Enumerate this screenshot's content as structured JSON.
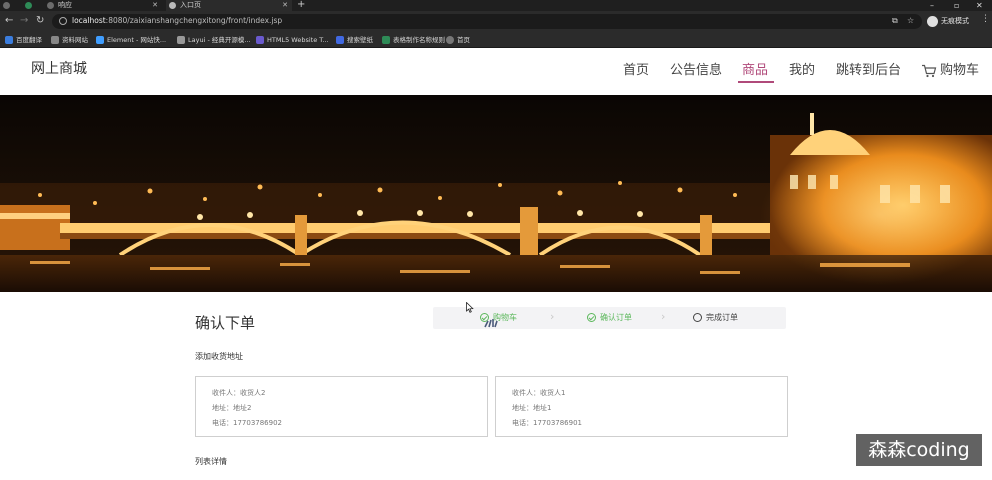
{
  "browser": {
    "tabs": [
      {
        "label": "",
        "active": false
      },
      {
        "label": "",
        "active": false
      },
      {
        "label": "响应",
        "active": false
      },
      {
        "label": "入口页",
        "active": true
      }
    ],
    "url_host": "localhost",
    "url_rest": ":8080/zaixianshangchengxitong/front/index.jsp",
    "profile_label": "无痕模式",
    "bookmarks": [
      {
        "label": "百度翻译",
        "color": "#3b7ddd"
      },
      {
        "label": "资料网站",
        "color": "#888888"
      },
      {
        "label": "Element - 网站快...",
        "color": "#409eff"
      },
      {
        "label": "Layui - 经典开源模...",
        "color": "#999999"
      },
      {
        "label": "HTML5 Website T...",
        "color": "#6a5acd"
      },
      {
        "label": "搜索壁纸",
        "color": "#4169e1"
      },
      {
        "label": "表格制作名称规则",
        "color": "#2e8b57"
      },
      {
        "label": "首页",
        "color": "#777777"
      }
    ]
  },
  "site": {
    "logo": "网上商城",
    "menu": [
      {
        "label": "首页",
        "active": false
      },
      {
        "label": "公告信息",
        "active": false
      },
      {
        "label": "商品",
        "active": true
      },
      {
        "label": "我的",
        "active": false
      },
      {
        "label": "跳转到后台",
        "active": false
      },
      {
        "label": "购物车",
        "active": false
      }
    ],
    "accent_color": "#b04a7a"
  },
  "order": {
    "title": "确认下单",
    "steps": [
      {
        "label": "购物车",
        "status": "done"
      },
      {
        "label": "确认订单",
        "status": "done"
      },
      {
        "label": "完成订单",
        "status": "todo"
      }
    ],
    "add_address_label": "添加收货地址",
    "addresses": [
      {
        "recipient": "收件人：收货人2",
        "address": "地址：地址2",
        "phone": "电话：17703786902"
      },
      {
        "recipient": "收件人：收货人1",
        "address": "地址：地址1",
        "phone": "电话：17703786901"
      }
    ],
    "list_title": "列表详情"
  },
  "watermark": "森森coding"
}
